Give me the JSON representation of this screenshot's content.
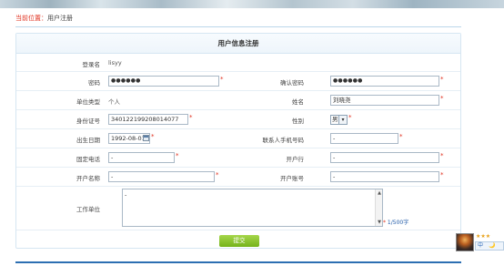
{
  "breadcrumb": {
    "prefix": "当前位置：",
    "page": "用户注册"
  },
  "form": {
    "title": "用户信息注册",
    "fields": {
      "login_name": {
        "label": "登录名",
        "value": "lisyy"
      },
      "password": {
        "label": "密码",
        "value": "●●●●●●"
      },
      "confirm_password": {
        "label": "确认密码",
        "value": "●●●●●●"
      },
      "unit_type": {
        "label": "单位类型",
        "value": "个人"
      },
      "name": {
        "label": "姓名",
        "value": "刘晓尧"
      },
      "id_number": {
        "label": "身份证号",
        "value": "340122199208014077"
      },
      "gender": {
        "label": "性别",
        "value": "男"
      },
      "birth_date": {
        "label": "出生日期",
        "value": "1992-08-01"
      },
      "contact_mobile": {
        "label": "联系人手机号码",
        "value": "-"
      },
      "landline": {
        "label": "固定电话",
        "value": "-"
      },
      "bank": {
        "label": "开户行",
        "value": "-"
      },
      "account_name": {
        "label": "开户名称",
        "value": "-"
      },
      "account_number": {
        "label": "开户账号",
        "value": "-"
      },
      "work_unit": {
        "label": "工作单位",
        "value": "-"
      }
    },
    "required_mark": "*",
    "char_counter": "1/500字",
    "submit_label": "提交"
  },
  "widget": {
    "stars": "★★★",
    "bar_text_1": "中",
    "bar_text_2": "🌙"
  },
  "colors": {
    "accent_red": "#e0301e",
    "link_blue": "#1f5aa8",
    "submit_green": "#8cc63f",
    "bottom_rule": "#2d6fb2"
  }
}
